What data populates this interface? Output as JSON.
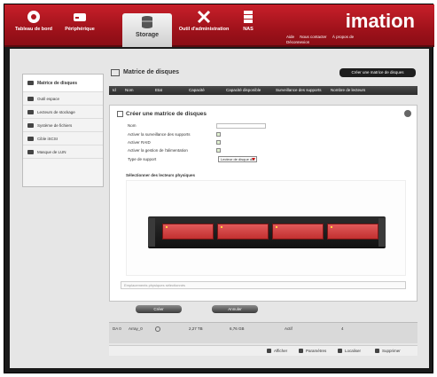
{
  "header": {
    "brand": "imation",
    "nav": [
      {
        "label": "Tableau de bord",
        "icon": "dashboard-icon"
      },
      {
        "label": "Périphérique",
        "icon": "device-icon"
      },
      {
        "label": "Storage",
        "icon": "storage-icon"
      },
      {
        "label": "Outil d'administration",
        "icon": "tools-icon"
      },
      {
        "label": "NAS",
        "icon": "server-icon"
      }
    ],
    "links": [
      "Aide",
      "Nous contacter",
      "À propos de",
      "Déconnexion"
    ]
  },
  "sidebar": {
    "items": [
      {
        "label": "Matrice de disques"
      },
      {
        "label": "Outil espace"
      },
      {
        "label": "Lecteurs de stockage"
      },
      {
        "label": "Système de fichiers"
      },
      {
        "label": "Cible iSCSI"
      },
      {
        "label": "Masque de LUN"
      }
    ]
  },
  "main": {
    "title": "Matrice de disques",
    "create_button": "Créer une matrice de disques",
    "columns": [
      "Id",
      "Nom",
      "Etat",
      "Capacité",
      "Capacité disponible",
      "Surveillance des supports",
      "Nombre de lecteurs"
    ],
    "form": {
      "title": "Créer une matrice de disques",
      "name_label": "Nom",
      "name_value": "",
      "monitoring_label": "Activer la surveillance des supports",
      "raid_label": "Activer RAID",
      "auto_label": "Activer la gestion de l'alimentation",
      "type_label": "Type de support",
      "type_value": "Lecteur de disque dur",
      "select_drives_label": "Sélectionner des lecteurs physiques",
      "slot_placeholder": "Emplacements physiques sélectionnés",
      "ok_button": "Créer",
      "cancel_button": "Annuler"
    },
    "existing_array": {
      "id": "DA 0",
      "name": "Array_0",
      "state_icon": "warning-icon",
      "capacity": "2,27 TB",
      "available": "6,76 GB",
      "monitoring": "Actif",
      "drives": "4"
    },
    "row_actions": [
      "Afficher",
      "Paramètres",
      "Localiser",
      "Supprimer"
    ]
  }
}
